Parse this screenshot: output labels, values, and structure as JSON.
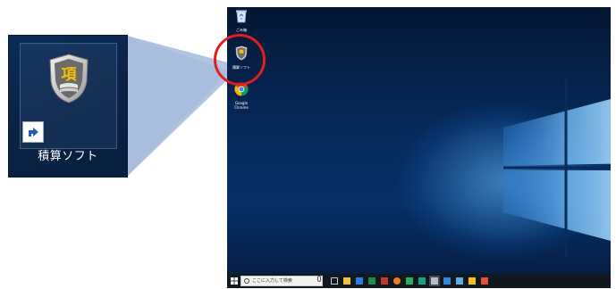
{
  "zoom": {
    "shield_char": "項",
    "label": "積算ソフト"
  },
  "desktop": {
    "icons": [
      {
        "label": "ごみ箱",
        "icon": "recycle-bin-icon"
      },
      {
        "label": "積算ソフト",
        "icon": "shield-app-icon"
      },
      {
        "label": "Google Chrome",
        "icon": "chrome-icon"
      }
    ]
  },
  "taskbar": {
    "search_placeholder": "ここに入力して検索",
    "apps": [
      "task-view-icon",
      "file-explorer-icon",
      "store-icon",
      "mail-icon",
      "calendar-icon",
      "chrome-icon",
      "maps-icon",
      "app-icon",
      "shield-app-icon",
      "settings-icon",
      "people-icon",
      "notes-icon",
      "pdf-icon"
    ]
  },
  "colors": {
    "highlight": "#e01e1e",
    "desktop_bg": "#072a5c",
    "taskbar_bg": "#101820"
  }
}
